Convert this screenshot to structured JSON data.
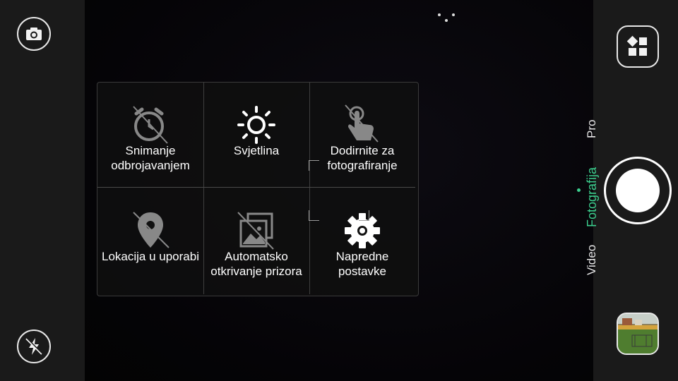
{
  "menu": {
    "items": [
      {
        "label": "Snimanje\nodbrojavanjem",
        "icon": "timer-off-icon"
      },
      {
        "label": "Svjetlina",
        "icon": "brightness-icon"
      },
      {
        "label": "Dodirnite za\nfotografiranje",
        "icon": "touch-capture-off-icon"
      },
      {
        "label": "Lokacija u uporabi",
        "icon": "location-off-icon"
      },
      {
        "label": "Automatsko\notkrivanje prizora",
        "icon": "scene-detect-off-icon"
      },
      {
        "label": "Napredne\npostavke",
        "icon": "gear-icon"
      }
    ]
  },
  "modes": {
    "pro": "Pro",
    "photo": "Fotografija",
    "video": "Video",
    "active_color": "#3ccf8e"
  },
  "left_controls": {
    "switch_camera_icon": "switch-camera-icon",
    "flash_icon": "flash-off-icon"
  }
}
